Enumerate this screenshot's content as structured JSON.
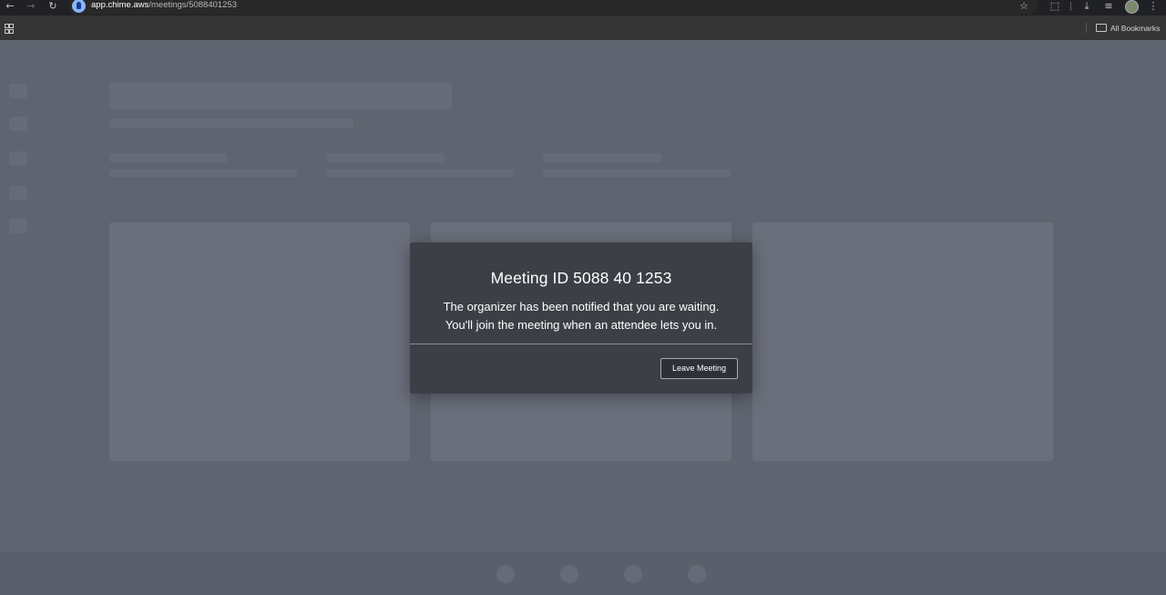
{
  "browser": {
    "url_host": "app.chime.aws",
    "url_path": "/meetings/5088401253",
    "icons": {
      "back": "arrow-left-icon",
      "forward": "arrow-right-icon",
      "reload": "reload-icon",
      "bookmark": "star-icon",
      "extensions": "puzzle-icon",
      "downloads": "download-icon",
      "media": "playlist-icon",
      "menu": "kebab-menu-icon"
    },
    "glyphs": {
      "back": "←",
      "forward": "→",
      "reload": "↻",
      "star": "☆",
      "extensions": "⬚",
      "download": "⤓",
      "media": "≡",
      "menu": "⋮"
    },
    "bookmarks_folder_label": "All Bookmarks"
  },
  "modal": {
    "title": "Meeting ID 5088 40 1253",
    "message_line1": "The organizer has been notified that you are waiting.",
    "message_line2": "You'll join the meeting when an attendee lets you in.",
    "leave_button_label": "Leave Meeting"
  },
  "colors": {
    "overlay_background": "#5f6470",
    "modal_background": "#3c3f46",
    "browser_chrome": "#202124",
    "bookmarks_bar": "#353535"
  }
}
